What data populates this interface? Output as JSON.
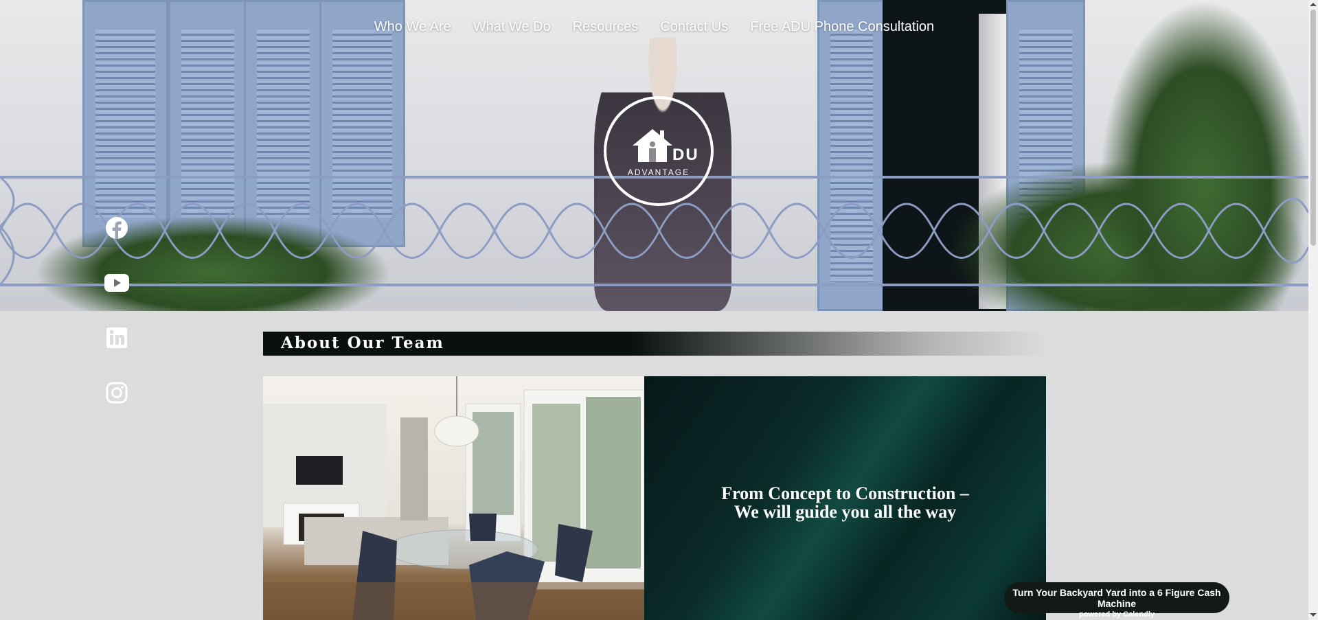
{
  "nav": {
    "items": [
      {
        "label": "Who We Are"
      },
      {
        "label": "What We Do"
      },
      {
        "label": "Resources"
      },
      {
        "label": "Contact Us"
      },
      {
        "label": "Free ADU Phone Consultation"
      }
    ]
  },
  "logo": {
    "letters": "DU",
    "tagline": "ADVANTAGE"
  },
  "social": [
    {
      "icon": "facebook-icon"
    },
    {
      "icon": "youtube-icon"
    },
    {
      "icon": "linkedin-icon"
    },
    {
      "icon": "instagram-icon"
    }
  ],
  "section": {
    "title": "About Our Team",
    "panel_heading_line1": "From Concept to Construction –",
    "panel_heading_line2": "We will guide you all the way"
  },
  "calendly": {
    "title": "Turn Your Backyard Yard into a 6 Figure Cash Machine",
    "subtitle": "powered by Calendly"
  },
  "colors": {
    "title_bar": "#0a1010",
    "panel": "#0a2a28",
    "page_bg": "#dcdcdc"
  }
}
